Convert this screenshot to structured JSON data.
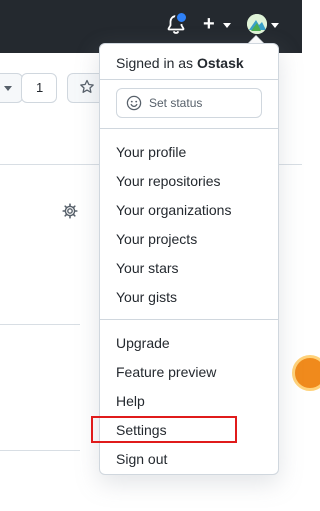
{
  "header": {
    "notifications_icon": "bell-icon",
    "create_icon": "plus-icon",
    "profile_icon": "avatar"
  },
  "background": {
    "count": "1",
    "star_icon": "star-icon",
    "settings_icon": "gear-icon"
  },
  "menu": {
    "signed_in_prefix": "Signed in as",
    "username": "Ostask",
    "set_status_label": "Set status",
    "group1": [
      "Your profile",
      "Your repositories",
      "Your organizations",
      "Your projects",
      "Your stars",
      "Your gists"
    ],
    "group2": [
      "Upgrade",
      "Feature preview",
      "Help",
      "Settings",
      "Sign out"
    ]
  },
  "colors": {
    "header_bg": "#24292f",
    "notification_dot": "#2f81f7",
    "highlight_border": "#e01b1b"
  }
}
